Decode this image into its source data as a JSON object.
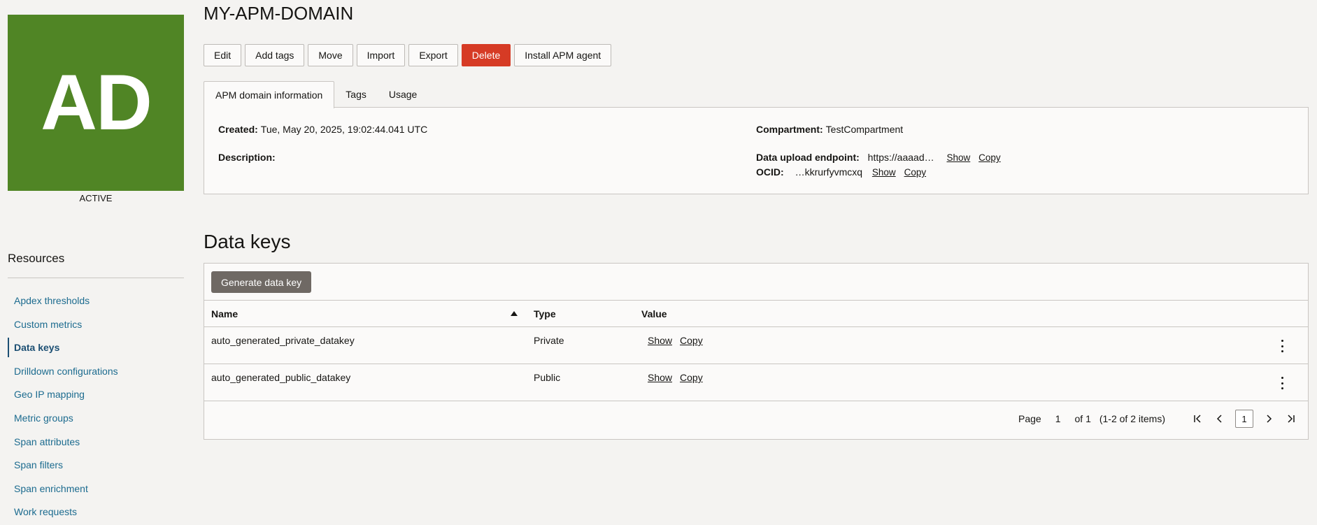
{
  "avatar": {
    "initials": "AD",
    "color": "#508525"
  },
  "status": "ACTIVE",
  "title": "MY-APM-DOMAIN",
  "toolbar": {
    "edit": "Edit",
    "add_tags": "Add tags",
    "move": "Move",
    "import": "Import",
    "export": "Export",
    "delete": "Delete",
    "install_agent": "Install APM agent"
  },
  "tabs": [
    {
      "label": "APM domain information"
    },
    {
      "label": "Tags"
    },
    {
      "label": "Usage"
    }
  ],
  "info": {
    "created_label": "Created:",
    "created_value": "Tue, May 20, 2025, 19:02:44.041 UTC",
    "description_label": "Description:",
    "compartment_label": "Compartment:",
    "compartment_value": "TestCompartment",
    "endpoint_label": "Data upload endpoint:",
    "endpoint_value": "https://aaaad…",
    "ocid_label": "OCID:",
    "ocid_value": "…kkrurfyvmcxq",
    "show": "Show",
    "copy": "Copy"
  },
  "resources": {
    "title": "Resources",
    "items": [
      {
        "label": "Apdex thresholds"
      },
      {
        "label": "Custom metrics"
      },
      {
        "label": "Data keys"
      },
      {
        "label": "Drilldown configurations"
      },
      {
        "label": "Geo IP mapping"
      },
      {
        "label": "Metric groups"
      },
      {
        "label": "Span attributes"
      },
      {
        "label": "Span filters"
      },
      {
        "label": "Span enrichment"
      },
      {
        "label": "Work requests"
      }
    ]
  },
  "data_keys": {
    "title": "Data keys",
    "generate_button": "Generate data key",
    "columns": {
      "name": "Name",
      "type": "Type",
      "value": "Value"
    },
    "rows": [
      {
        "name": "auto_generated_private_datakey",
        "type": "Private",
        "show": "Show",
        "copy": "Copy"
      },
      {
        "name": "auto_generated_public_datakey",
        "type": "Public",
        "show": "Show",
        "copy": "Copy"
      }
    ],
    "pagination": {
      "page_label": "Page",
      "page_number": "1",
      "of_label": "of 1",
      "items_label": "(1-2 of 2 items)",
      "current": "1"
    }
  },
  "colors": {
    "link": "#1c6b8f",
    "danger": "#d63b25",
    "generate": "#6f6964"
  }
}
